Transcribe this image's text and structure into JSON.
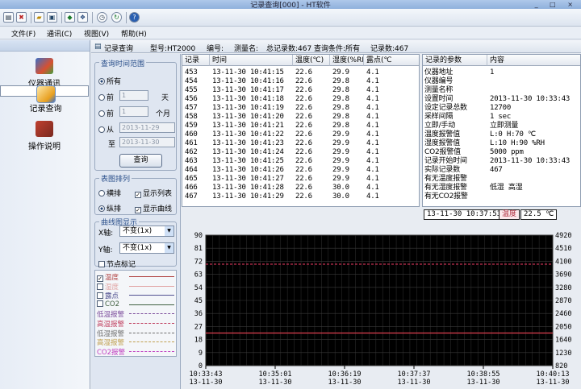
{
  "window": {
    "title": "记录查询[000] - HT软件",
    "controls": "_ □ ×"
  },
  "toolbar": {
    "icons": [
      "open-icon",
      "delete-icon",
      "folder-icon",
      "save-icon",
      "export-icon",
      "link-icon",
      "clock-icon",
      "refresh-icon",
      "help-icon"
    ]
  },
  "menu": [
    {
      "label": "文件(F)"
    },
    {
      "label": "通讯(C)"
    },
    {
      "label": "视图(V)"
    },
    {
      "label": "帮助(H)"
    }
  ],
  "nav": [
    {
      "label": "仪器通讯"
    },
    {
      "label": "记录查询"
    },
    {
      "label": "操作说明"
    }
  ],
  "strip": {
    "title": "记录查询",
    "model": "型号:HT2000",
    "serial": "编号:",
    "measure": "测量名:",
    "total": "总记录数:467",
    "condition": "查询条件:所有",
    "count": "记录数:467"
  },
  "query": {
    "group_title": "查询时间范围",
    "all": "所有",
    "recent1": "前",
    "recent1_value": "1",
    "recent1_unit": "天",
    "recent2": "前",
    "recent2_value": "1",
    "recent2_unit": "个月",
    "from_label": "从",
    "from_date": "2013-11-29",
    "to_label": "至",
    "to_date": "2013-11-30",
    "button": "查询"
  },
  "layout_opts": {
    "group_title": "表图排列",
    "horizontal": "横排",
    "vertical": "纵排",
    "show_list": "显示列表",
    "show_curve": "显示曲线"
  },
  "curve_opts": {
    "group_title": "曲线图显示",
    "x_label": "X轴:",
    "x_value": "不变(1x)",
    "y_label": "Y轴:",
    "y_value": "不变(1x)",
    "node_mark": "节点标记"
  },
  "legend": [
    {
      "label": "温度",
      "checked": true,
      "color": "#b04040",
      "style": "solid"
    },
    {
      "label": "湿度",
      "checked": false,
      "color": "#e0a0a0",
      "style": "solid"
    },
    {
      "label": "露点",
      "checked": false,
      "color": "#505090",
      "style": "solid"
    },
    {
      "label": "CO2",
      "checked": false,
      "color": "#406040",
      "style": "solid"
    },
    {
      "label": "低温报警",
      "checked": null,
      "color": "#7a4a9a",
      "style": "dashed"
    },
    {
      "label": "高温报警",
      "checked": null,
      "color": "#c04060",
      "style": "dashed"
    },
    {
      "label": "低湿报警",
      "checked": null,
      "color": "#707070",
      "style": "dashed"
    },
    {
      "label": "高湿报警",
      "checked": null,
      "color": "#c0a050",
      "style": "dashed"
    },
    {
      "label": "CO2报警",
      "checked": null,
      "color": "#c040c0",
      "style": "dashed"
    }
  ],
  "records": {
    "columns": [
      "记录",
      "时间",
      "温度(℃)",
      "湿度(%RH)",
      "露点(℃"
    ],
    "rows": [
      [
        "453",
        "13-11-30",
        "10:41:15",
        "22.6",
        "29.9",
        "4.1"
      ],
      [
        "454",
        "13-11-30",
        "10:41:16",
        "22.6",
        "29.8",
        "4.1"
      ],
      [
        "455",
        "13-11-30",
        "10:41:17",
        "22.6",
        "29.8",
        "4.1"
      ],
      [
        "456",
        "13-11-30",
        "10:41:18",
        "22.6",
        "29.8",
        "4.1"
      ],
      [
        "457",
        "13-11-30",
        "10:41:19",
        "22.6",
        "29.8",
        "4.1"
      ],
      [
        "458",
        "13-11-30",
        "10:41:20",
        "22.6",
        "29.8",
        "4.1"
      ],
      [
        "459",
        "13-11-30",
        "10:41:21",
        "22.6",
        "29.8",
        "4.1"
      ],
      [
        "460",
        "13-11-30",
        "10:41:22",
        "22.6",
        "29.9",
        "4.1"
      ],
      [
        "461",
        "13-11-30",
        "10:41:23",
        "22.6",
        "29.9",
        "4.1"
      ],
      [
        "462",
        "13-11-30",
        "10:41:24",
        "22.6",
        "29.9",
        "4.1"
      ],
      [
        "463",
        "13-11-30",
        "10:41:25",
        "22.6",
        "29.9",
        "4.1"
      ],
      [
        "464",
        "13-11-30",
        "10:41:26",
        "22.6",
        "29.9",
        "4.1"
      ],
      [
        "465",
        "13-11-30",
        "10:41:27",
        "22.6",
        "29.9",
        "4.1"
      ],
      [
        "466",
        "13-11-30",
        "10:41:28",
        "22.6",
        "30.0",
        "4.1"
      ],
      [
        "467",
        "13-11-30",
        "10:41:29",
        "22.6",
        "30.0",
        "4.1"
      ]
    ]
  },
  "params": {
    "columns": [
      "记录的参数",
      "内容"
    ],
    "rows": [
      [
        "仪器地址",
        "1"
      ],
      [
        "仪器编号",
        ""
      ],
      [
        "测量名称",
        ""
      ],
      [
        "设置时间",
        "2013-11-30 10:33:43"
      ],
      [
        "设定记录总数",
        "12700"
      ],
      [
        "采样间隔",
        "1 sec"
      ],
      [
        "立即/手动",
        "立即测量"
      ],
      [
        "温度报警值",
        "L:0 H:70 ℃"
      ],
      [
        "湿度报警值",
        "L:10 H:90 %RH"
      ],
      [
        "CO2报警值",
        "5000 ppm"
      ],
      [
        "记录开始时间",
        "2013-11-30 10:33:43"
      ],
      [
        "实际记录数",
        "467"
      ],
      [
        "有无温度报警",
        ""
      ],
      [
        "有无湿度报警",
        "低湿 高湿"
      ],
      [
        "有无CO2报警",
        ""
      ]
    ]
  },
  "chart_data": {
    "type": "line",
    "cursor_time": "13-11-30 10:37:53",
    "cursor_label": "温度",
    "cursor_value": "22.5 ℃",
    "y_left_ticks": [
      "90",
      "81",
      "72",
      "63",
      "54",
      "45",
      "36",
      "27",
      "18",
      "9",
      "0"
    ],
    "y_right_ticks": [
      "4920",
      "4510",
      "4100",
      "3690",
      "3280",
      "2870",
      "2460",
      "2050",
      "1640",
      "1230",
      "820"
    ],
    "ylim": [
      0,
      90
    ],
    "x_ticks": [
      {
        "time": "10:33:43",
        "date": "13-11-30"
      },
      {
        "time": "10:35:01",
        "date": "13-11-30"
      },
      {
        "time": "10:36:19",
        "date": "13-11-30"
      },
      {
        "time": "10:37:37",
        "date": "13-11-30"
      },
      {
        "time": "10:38:55",
        "date": "13-11-30"
      },
      {
        "time": "10:40:13",
        "date": "13-11-30"
      }
    ],
    "series": [
      {
        "name": "温度",
        "color": "#e04050",
        "constant": 22.5
      },
      {
        "name": "高温报警",
        "color": "#c03050",
        "constant": 70,
        "style": "dashed"
      }
    ],
    "grid": true,
    "background": "#000000"
  }
}
